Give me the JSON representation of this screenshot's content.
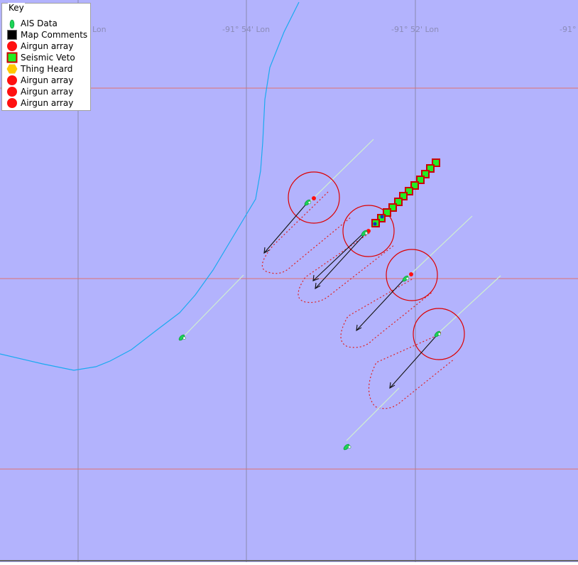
{
  "map": {
    "background": "#b3b3fd",
    "grid_color_vertical": "#8a8ab0",
    "grid_color_horizontal": "#e07070",
    "coast_color": "#1aaaf0",
    "lon_labels": [
      "Lon",
      "-91° 54' Lon",
      "-91° 52' Lon",
      "-91°"
    ]
  },
  "key": {
    "title": "Key",
    "items": [
      {
        "label": "AIS Data",
        "icon": "ship-icon",
        "color": "#1bd456"
      },
      {
        "label": "Map Comments",
        "icon": "square-icon",
        "color": "#000000"
      },
      {
        "label": "Airgun array",
        "icon": "circle-icon",
        "color": "#ff0000"
      },
      {
        "label": "Seismic Veto",
        "icon": "square-icon",
        "color": "#00ff00"
      },
      {
        "label": "Thing Heard",
        "icon": "hexagon-icon",
        "color": "#ffc800"
      },
      {
        "label": "Airgun array",
        "icon": "circle-icon",
        "color": "#ff0000"
      },
      {
        "label": "Airgun array",
        "icon": "circle-icon",
        "color": "#ff0000"
      },
      {
        "label": "Airgun array",
        "icon": "circle-icon",
        "color": "#ff0000"
      }
    ]
  }
}
